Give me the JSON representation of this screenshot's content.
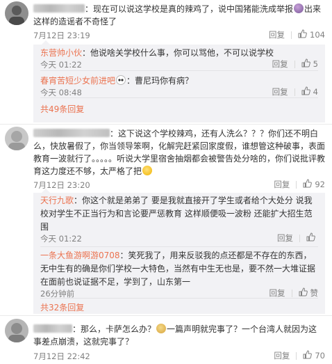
{
  "colors": {
    "link": "#eb7350",
    "text": "#333333",
    "meta": "#808080",
    "reply_bg": "#f2f2f5"
  },
  "actions": {
    "reply": "回复",
    "like_icon": "thumbs-up-icon"
  },
  "comments": [
    {
      "text_before_emoji": "：现在可以说这学校是真的辣鸡了，说中国猪能洗成举报",
      "emoji": "emoji-face-icon",
      "text_after_emoji": "出来这样的造谣者不奇怪了",
      "time": "7月12日 23:19",
      "likes": "104",
      "replies": [
        {
          "user": "东营帅小伙",
          "text": "：他说啥关学校什么事，你可以骂他，不可以说学校",
          "time": "今天 01:22",
          "likes": "5"
        },
        {
          "user": "春宵苦短少女前进吧",
          "text_after_emoji": "：曹尼玛你有病？",
          "emoji": "panda-emoji-icon",
          "time": "今天 08:48",
          "likes": "4"
        }
      ],
      "total": "共49条回复"
    },
    {
      "text_before_emoji": "：这下说这个学校辣鸡，还有人洗么？？？你们还不明白么，快放暑假了，你当领导笨啊，化解完赶紧回家度假，谁想管这种破事，表面教育一波就行了。。。。。听说大学里宿舍抽烟都会被警告处分啥的，你们说批评教育这力度还不够，太严格了把",
      "emoji": "smile-emoji-icon",
      "time": "7月12日 23:20",
      "likes": "92",
      "replies": [
        {
          "user": "天行九歌",
          "text": "：你这个就是弟弟了 要是我就直接开了学生或者给个大处分 说我校对学生不正当行为和言论要严惩教育 这样顺便吸一波粉 还能扩大招生范围",
          "time": "今天 01:22",
          "likes": ""
        },
        {
          "user": "一条大鱼游啊游0708",
          "text": "：笑死我了，用来反驳我的点还都是不存在的东西，无中生有的确是你们学校一大特色，当然有中生无也是，要不然一大堆证据在面前也说证据不足，学到了，山东第一",
          "time": "26分钟前",
          "likes": "赞"
        }
      ],
      "total": "共32条回复"
    },
    {
      "text_before_emoji": "：那么，卡萨怎么办？",
      "emoji": "doge-emoji-icon",
      "text_after_emoji": "一篇声明就完事了？一个台湾人就因为这事差点崩溃，这就完事了？",
      "time": "7月12日 22:42",
      "likes": "70"
    }
  ]
}
